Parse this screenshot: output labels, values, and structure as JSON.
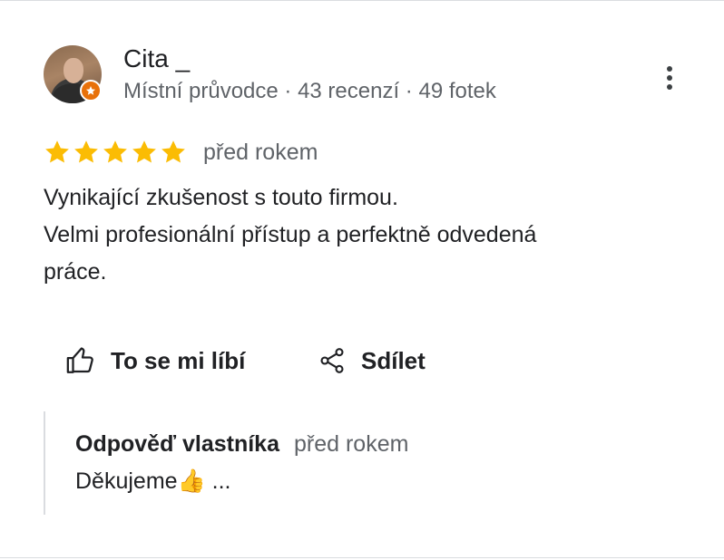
{
  "author": {
    "name": "Cita _",
    "meta": "Místní průvodce · 43 recenzí · 49 fotek",
    "avatar_icon": "user-photo",
    "badge_icon": "local-guide-star-icon",
    "badge_color": "#e8710a"
  },
  "more_icon": "more-vert-icon",
  "review": {
    "rating": 5,
    "rating_max": 5,
    "star_color": "#fbbc04",
    "date": "před rokem",
    "text_lines": [
      "Vynikající zkušenost s touto firmou.",
      "Velmi profesionální přístup a perfektně odvedená",
      "práce."
    ]
  },
  "actions": {
    "like_label": "To se mi líbí",
    "like_icon": "thumb-up-icon",
    "share_label": "Sdílet",
    "share_icon": "share-icon"
  },
  "owner_reply": {
    "label": "Odpověď vlastníka",
    "date": "před rokem",
    "text": "Děkujeme👍 ..."
  }
}
